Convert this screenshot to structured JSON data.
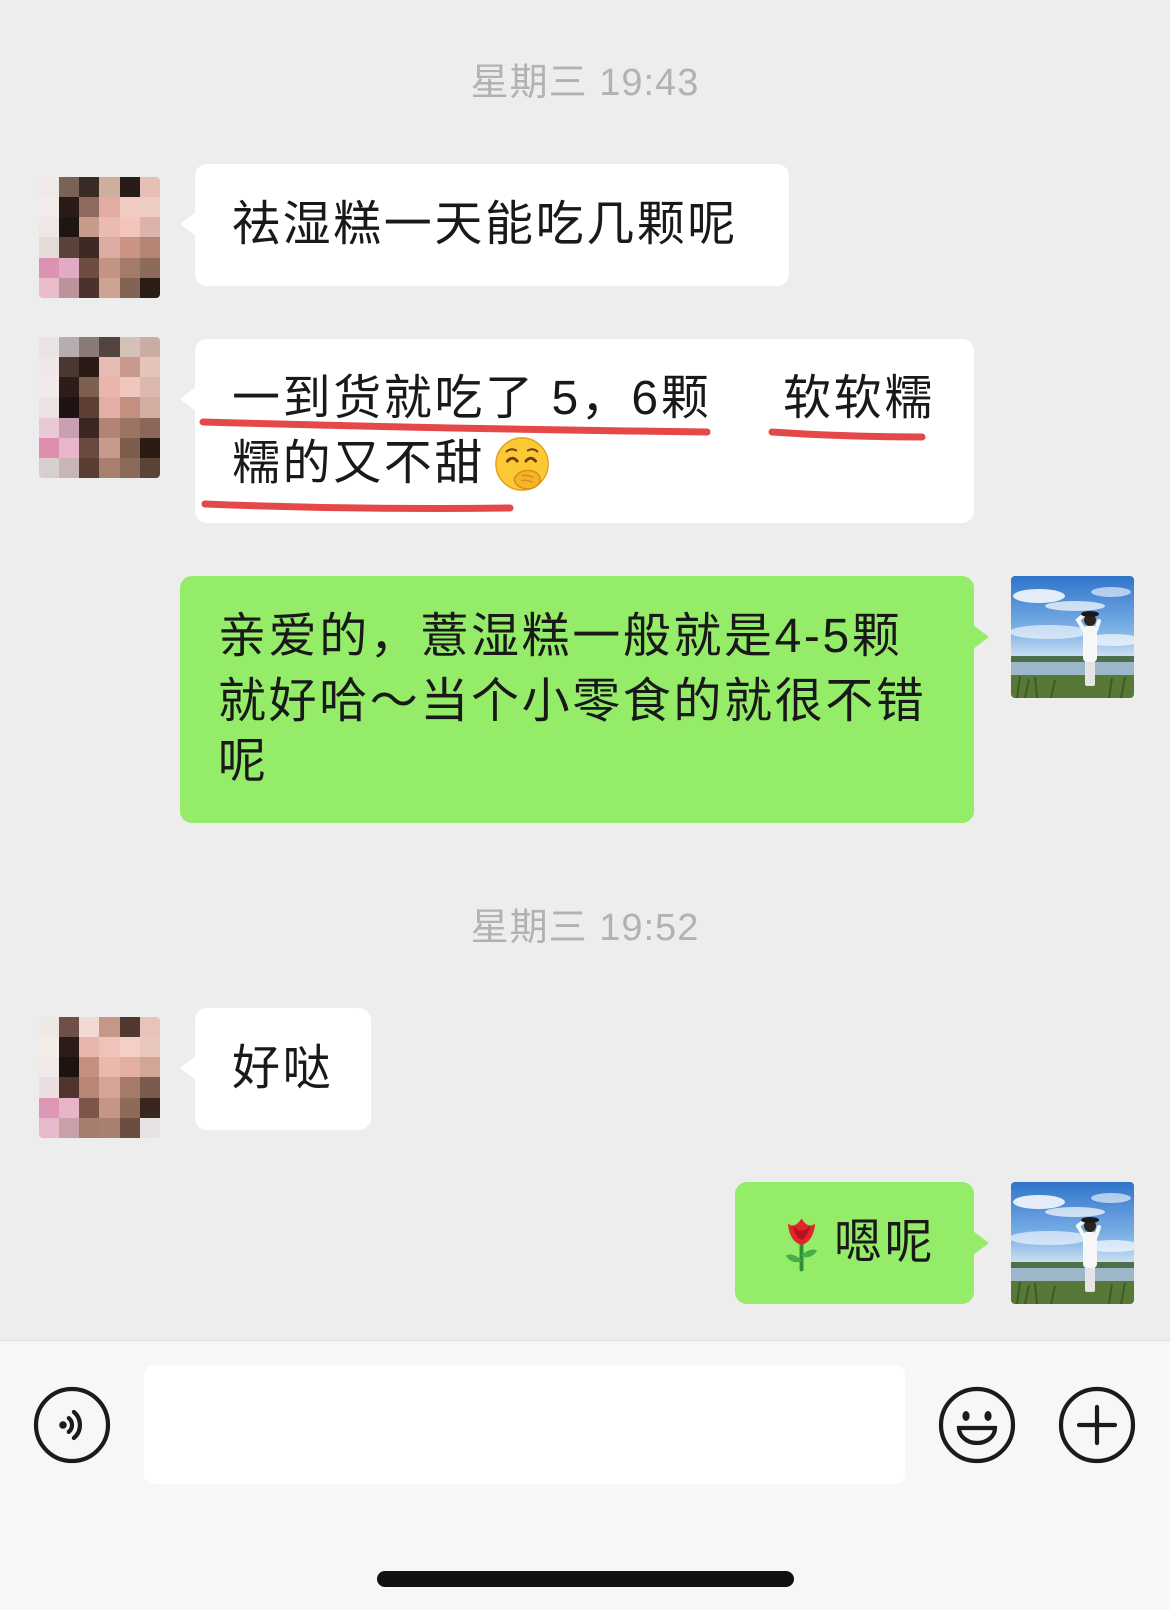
{
  "timestamps": [
    "星期三 19:43",
    "星期三 19:52"
  ],
  "messages": [
    {
      "text": "祛湿糕一天能吃几颗呢"
    },
    {
      "lines": [
        [
          "一到货就吃了 5，6颗",
          "软软糯"
        ],
        [
          "糯的又不甜"
        ]
      ],
      "emoji_icon": "face-with-hand-over-mouth-emoji"
    },
    {
      "lines": [
        "亲爱的，薏湿糕一般就是4-5颗",
        "就好哈～当个小零食的就很不错",
        "呢"
      ]
    },
    {
      "text": "好哒"
    },
    {
      "emoji_icon": "rose-emoji",
      "text": "嗯呢"
    }
  ],
  "input_bar": {
    "voice_icon": "voice-icon",
    "message_input": {
      "value": "",
      "placeholder": ""
    },
    "emoji_icon": "smiley-icon",
    "more_icon": "plus-circle-icon"
  },
  "colors": {
    "chat_background": "#ededed",
    "incoming_bubble": "#ffffff",
    "outgoing_bubble": "#95ec69",
    "timestamp_text": "#b2b2b2",
    "underline_annotation": "#e54848",
    "input_bar_background": "#f7f7f7",
    "icon_stroke": "#1b1b1b"
  }
}
